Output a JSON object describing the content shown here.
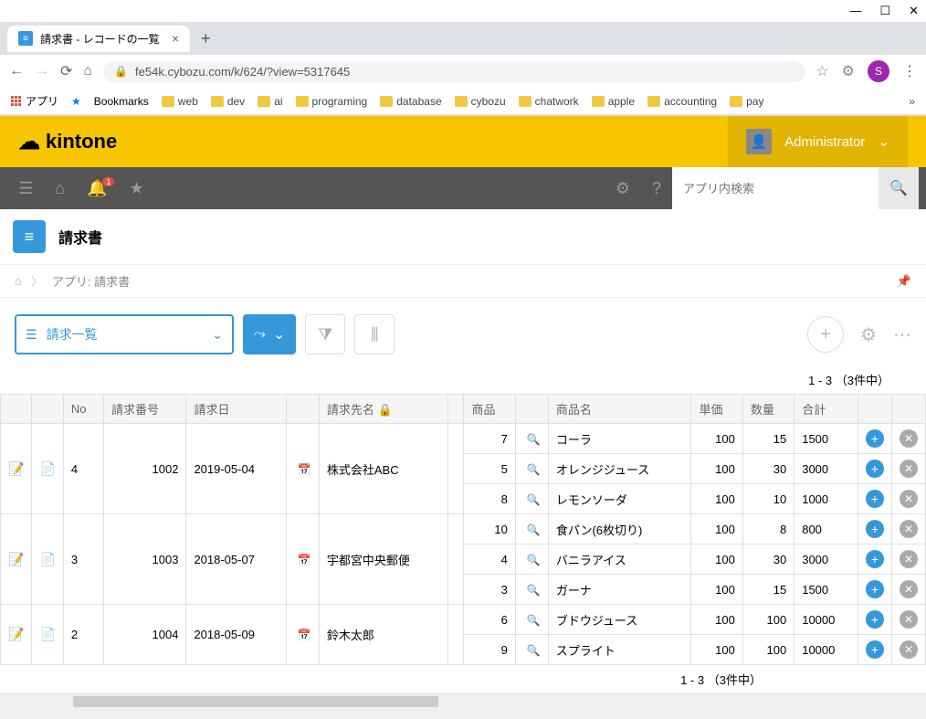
{
  "browser": {
    "tab_title": "請求書 - レコードの一覧",
    "url": "fe54k.cybozu.com/k/624/?view=5317645",
    "avatar_letter": "S",
    "bookmarks_bar": {
      "apps": "アプリ",
      "bookmarks": "Bookmarks",
      "folders": [
        "web",
        "dev",
        "ai",
        "programing",
        "database",
        "cybozu",
        "chatwork",
        "apple",
        "accounting",
        "pay"
      ]
    }
  },
  "kintone": {
    "logo": "kintone",
    "user": "Administrator",
    "notification_count": "1",
    "search_placeholder": "アプリ内検索"
  },
  "app": {
    "title": "請求書",
    "breadcrumb": "アプリ: 請求書",
    "view_name": "請求一覧",
    "pagination": "1 - 3 （3件中）"
  },
  "table": {
    "headers": {
      "no": "No",
      "invoice_no": "請求番号",
      "invoice_date": "請求日",
      "bill_to": "請求先名",
      "product": "商品",
      "product_name": "商品名",
      "unit_price": "単価",
      "qty": "数量",
      "total": "合計"
    },
    "records": [
      {
        "no": "4",
        "invoice_no": "1002",
        "date": "2019-05-04",
        "bill_to": "株式会社ABC",
        "lines": [
          {
            "product": "7",
            "name": "コーラ",
            "price": "100",
            "qty": "15",
            "total": "1500"
          },
          {
            "product": "5",
            "name": "オレンジジュース",
            "price": "100",
            "qty": "30",
            "total": "3000"
          },
          {
            "product": "8",
            "name": "レモンソーダ",
            "price": "100",
            "qty": "10",
            "total": "1000"
          }
        ]
      },
      {
        "no": "3",
        "invoice_no": "1003",
        "date": "2018-05-07",
        "bill_to": "宇都宮中央郵便",
        "lines": [
          {
            "product": "10",
            "name": "食パン(6枚切り)",
            "price": "100",
            "qty": "8",
            "total": "800"
          },
          {
            "product": "4",
            "name": "バニラアイス",
            "price": "100",
            "qty": "30",
            "total": "3000"
          },
          {
            "product": "3",
            "name": "ガーナ",
            "price": "100",
            "qty": "15",
            "total": "1500"
          }
        ]
      },
      {
        "no": "2",
        "invoice_no": "1004",
        "date": "2018-05-09",
        "bill_to": "鈴木太郎",
        "lines": [
          {
            "product": "6",
            "name": "ブドウジュース",
            "price": "100",
            "qty": "100",
            "total": "10000"
          },
          {
            "product": "9",
            "name": "スプライト",
            "price": "100",
            "qty": "100",
            "total": "10000"
          }
        ]
      }
    ]
  }
}
